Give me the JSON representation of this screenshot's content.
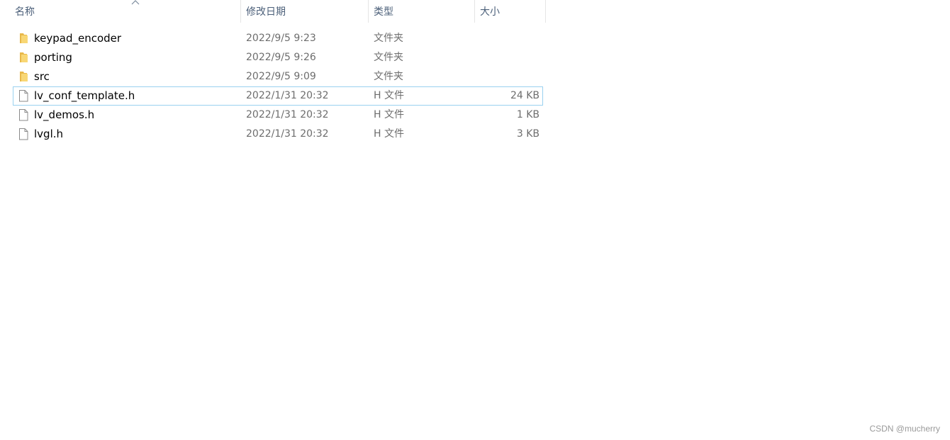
{
  "columns": {
    "name": "名称",
    "date": "修改日期",
    "type": "类型",
    "size": "大小"
  },
  "sort": {
    "column": "name",
    "direction": "ascending",
    "icon": "sort-up-icon"
  },
  "files": [
    {
      "name": "keypad_encoder",
      "date": "2022/9/5 9:23",
      "type": "文件夹",
      "size": "",
      "icon": "folder-icon",
      "selected": false
    },
    {
      "name": "porting",
      "date": "2022/9/5 9:26",
      "type": "文件夹",
      "size": "",
      "icon": "folder-icon",
      "selected": false
    },
    {
      "name": "src",
      "date": "2022/9/5 9:09",
      "type": "文件夹",
      "size": "",
      "icon": "folder-icon",
      "selected": false
    },
    {
      "name": "lv_conf_template.h",
      "date": "2022/1/31 20:32",
      "type": "H 文件",
      "size": "24 KB",
      "icon": "file-icon",
      "selected": true
    },
    {
      "name": "lv_demos.h",
      "date": "2022/1/31 20:32",
      "type": "H 文件",
      "size": "1 KB",
      "icon": "file-icon",
      "selected": false
    },
    {
      "name": "lvgl.h",
      "date": "2022/1/31 20:32",
      "type": "H 文件",
      "size": "3 KB",
      "icon": "file-icon",
      "selected": false
    }
  ],
  "watermark": "CSDN @mucherry",
  "colors": {
    "folder": "#f8d775",
    "selection_border": "#99d1f0",
    "header_text": "#4c607a",
    "meta_text": "#6d6d6d"
  }
}
